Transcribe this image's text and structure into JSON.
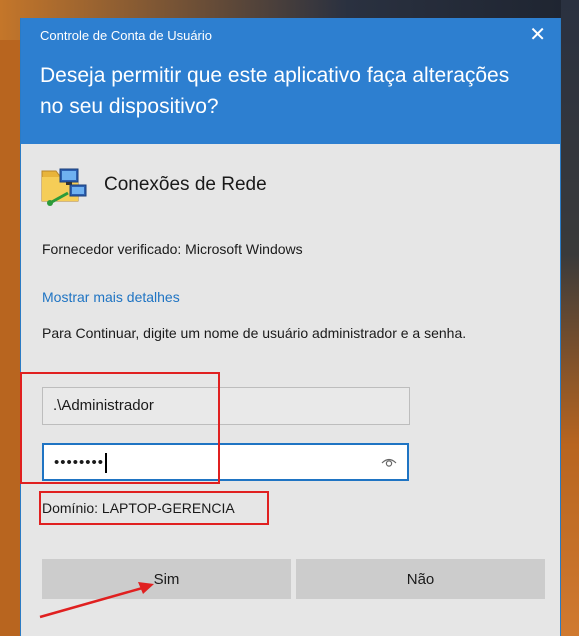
{
  "dialog": {
    "title": "Controle de Conta de Usuário",
    "question": "Deseja permitir que este aplicativo faça alterações no seu dispositivo?",
    "close_icon": "close-icon"
  },
  "app": {
    "icon": "network-connections-icon",
    "name": "Conexões de Rede"
  },
  "publisher": "Fornecedor verificado: Microsoft Windows",
  "details_link": "Mostrar mais detalhes",
  "instructions": "Para Continuar, digite um nome de usuário administrador e a senha.",
  "username": {
    "value": ".\\Administrador"
  },
  "password": {
    "masked_value": "••••••••",
    "reveal_icon": "eye-icon"
  },
  "domain": "Domínio: LAPTOP-GERENCIA",
  "buttons": {
    "yes": "Sim",
    "no": "Não"
  },
  "annotations": {
    "highlight_color": "#e02020"
  },
  "colors": {
    "header": "#2d7fd0",
    "link": "#1f74c3",
    "body": "#e6e6e6"
  }
}
